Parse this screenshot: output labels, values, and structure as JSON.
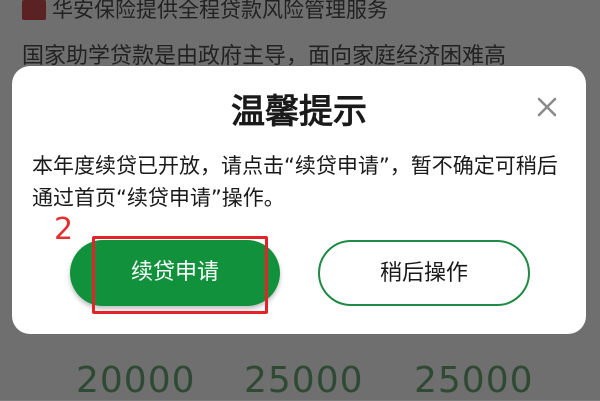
{
  "background": {
    "header_text": "华安保险提供全程贷款风险管理服务",
    "intro_text": "国家助学贷款是由政府主导，面向家庭经济困难高",
    "amounts": [
      "20000",
      "25000",
      "25000"
    ]
  },
  "dialog": {
    "title": "温馨提示",
    "message": "本年度续贷已开放，请点击“续贷申请”，暂不确定可稍后通过首页“续贷申请”操作。",
    "step_label": "2",
    "primary_button": "续贷申请",
    "secondary_button": "稍后操作"
  },
  "colors": {
    "primary": "#12913d",
    "highlight": "#e2242a",
    "overlay": "#6f6f6f"
  },
  "icons": {
    "close": "close-icon",
    "logo": "brand-logo-icon"
  }
}
